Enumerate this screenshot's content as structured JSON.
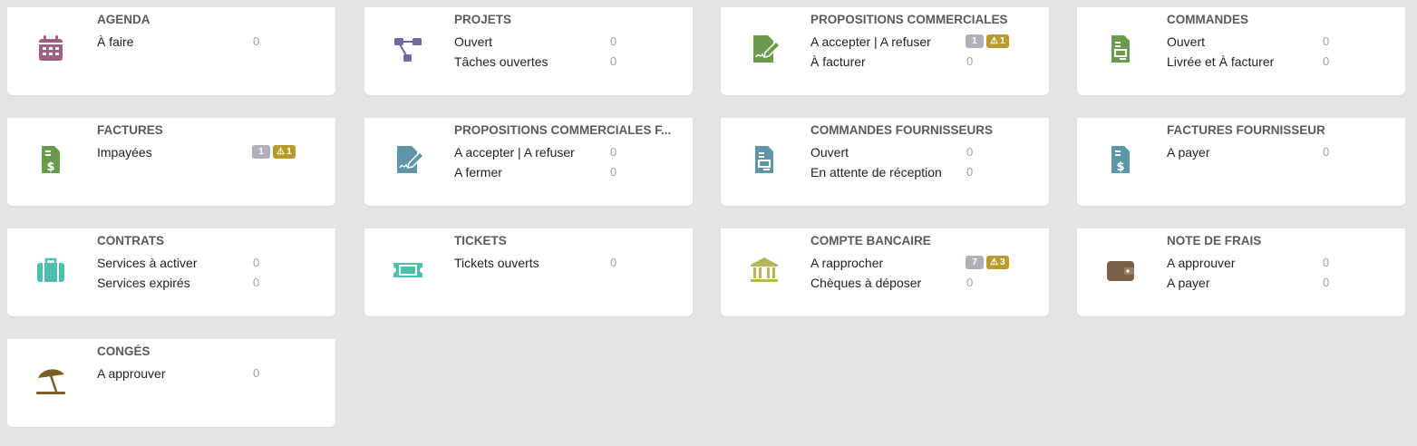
{
  "colors": {
    "agenda": "#a0607f",
    "projets": "#6c6aa0",
    "propal": "#6b9a4f",
    "commandes": "#6b9a4f",
    "factures": "#6b9a4f",
    "fournisseur": "#5f96a7",
    "contrats": "#4dbfae",
    "tickets": "#4dbfae",
    "banque": "#b7b55c",
    "notefrais": "#7a6048",
    "conges": "#7a5f28"
  },
  "cards": [
    {
      "title": "AGENDA",
      "icon": "calendar-icon",
      "rows": [
        {
          "label": "À faire",
          "value": "0"
        }
      ]
    },
    {
      "title": "PROJETS",
      "icon": "project-tree-icon",
      "rows": [
        {
          "label": "Ouvert",
          "value": "0"
        },
        {
          "label": "Tâches ouvertes",
          "value": "0"
        }
      ]
    },
    {
      "title": "PROPOSITIONS COMMERCIALES",
      "icon": "signed-document-icon",
      "rows": [
        {
          "label": "A accepter | A refuser",
          "badge": "1",
          "warn": "1"
        },
        {
          "label": "À facturer",
          "value": "0"
        }
      ]
    },
    {
      "title": "COMMANDES",
      "icon": "order-document-icon",
      "rows": [
        {
          "label": "Ouvert",
          "value": "0"
        },
        {
          "label": "Livrée et À facturer",
          "value": "0"
        }
      ]
    },
    {
      "title": "FACTURES",
      "icon": "invoice-icon",
      "rows": [
        {
          "label": "Impayées",
          "badge": "1",
          "warn": "1"
        }
      ]
    },
    {
      "title": "PROPOSITIONS COMMERCIALES FOURNISSEURS",
      "title_display": "PROPOSITIONS COMMERCIALES F...",
      "icon": "signed-document-icon",
      "rows": [
        {
          "label": "A accepter | A refuser",
          "value": "0"
        },
        {
          "label": "A fermer",
          "value": "0"
        }
      ]
    },
    {
      "title": "COMMANDES FOURNISSEURS",
      "icon": "order-document-icon",
      "rows": [
        {
          "label": "Ouvert",
          "value": "0"
        },
        {
          "label": "En attente de réception",
          "value": "0"
        }
      ]
    },
    {
      "title": "FACTURES FOURNISSEUR",
      "icon": "invoice-icon",
      "rows": [
        {
          "label": "A payer",
          "value": "0"
        }
      ]
    },
    {
      "title": "CONTRATS",
      "icon": "briefcase-icon",
      "rows": [
        {
          "label": "Services à activer",
          "value": "0"
        },
        {
          "label": "Services expirés",
          "value": "0"
        }
      ]
    },
    {
      "title": "TICKETS",
      "icon": "ticket-icon",
      "rows": [
        {
          "label": "Tickets ouverts",
          "value": "0"
        }
      ]
    },
    {
      "title": "COMPTE BANCAIRE",
      "icon": "bank-icon",
      "rows": [
        {
          "label": "A rapprocher",
          "badge": "7",
          "warn": "3"
        },
        {
          "label": "Chèques à déposer",
          "value": "0"
        }
      ]
    },
    {
      "title": "NOTE DE FRAIS",
      "icon": "wallet-icon",
      "rows": [
        {
          "label": "A approuver",
          "value": "0"
        },
        {
          "label": "A payer",
          "value": "0"
        }
      ]
    },
    {
      "title": "CONGÉS",
      "icon": "beach-umbrella-icon",
      "rows": [
        {
          "label": "A approuver",
          "value": "0"
        }
      ]
    }
  ]
}
